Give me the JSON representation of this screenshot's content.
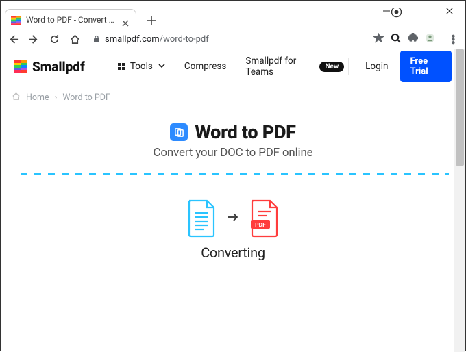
{
  "browser": {
    "tab_title": "Word to PDF - Convert your DOC",
    "url_host": "smallpdf.com",
    "url_path": "/word-to-pdf"
  },
  "header": {
    "brand": "Smallpdf",
    "tools_label": "Tools",
    "compress_label": "Compress",
    "teams_label": "Smallpdf for Teams",
    "teams_pill": "New",
    "login_label": "Login",
    "cta_label": "Free Trial"
  },
  "breadcrumb": {
    "home": "Home",
    "current": "Word to PDF"
  },
  "hero": {
    "title": "Word to PDF",
    "subtitle": "Convert your DOC to PDF online"
  },
  "status": {
    "label": "Converting",
    "pdf_badge": "PDF"
  },
  "colors": {
    "accent_blue": "#0051ff",
    "icon_blue": "#2d8bff",
    "dash_cyan": "#2ac4ff",
    "pdf_red": "#ff3d3d"
  }
}
